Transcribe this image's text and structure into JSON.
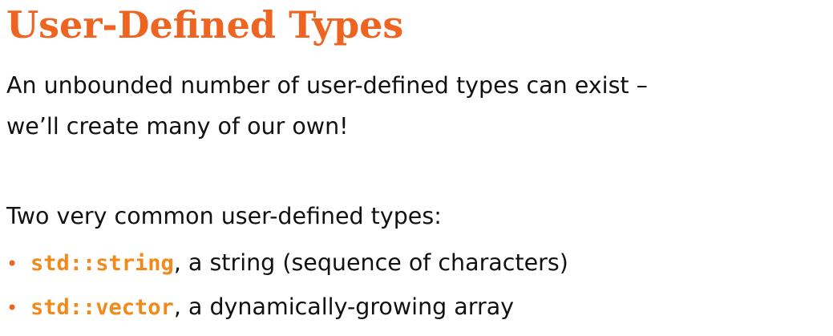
{
  "slide": {
    "title": "User-Defined Types",
    "paragraph1_line1": "An unbounded number of user-defined types can exist –",
    "paragraph1_line2": "we’ll create many of our own!",
    "paragraph2": "Two very common user-defined types:",
    "bullets": [
      {
        "marker": "•",
        "code": "std::string",
        "text": ", a string (sequence of characters)"
      },
      {
        "marker": "•",
        "code": "std::vector",
        "text": ", a dynamically-growing array"
      }
    ]
  },
  "colors": {
    "accent": "#ee6421",
    "code": "#f08a1a",
    "text": "#111111",
    "background": "#ffffff"
  }
}
